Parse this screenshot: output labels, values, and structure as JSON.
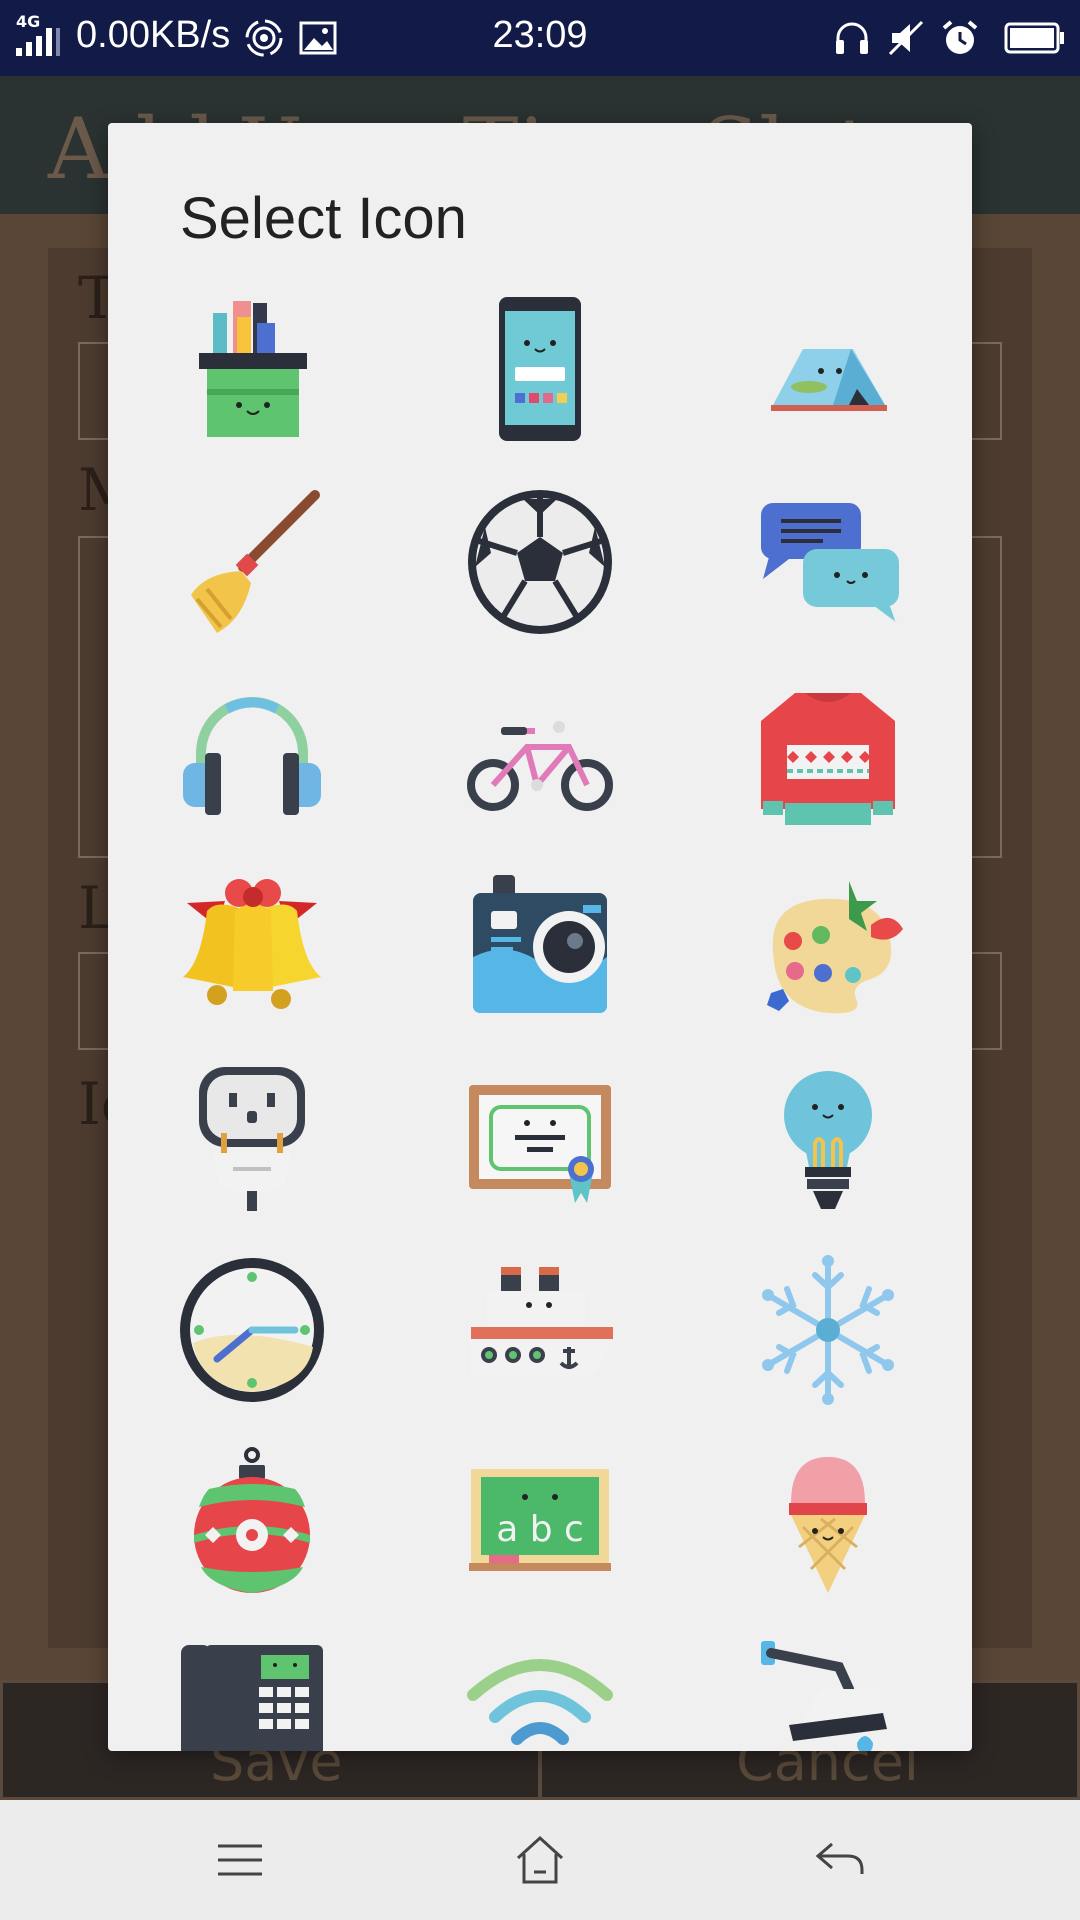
{
  "status_bar": {
    "network": "4G",
    "speed": "0.00KB/s",
    "time": "23:09",
    "icons": [
      "signal-icon",
      "hotspot-icon",
      "image-icon",
      "headphones-icon",
      "mute-icon",
      "alarm-icon",
      "battery-icon"
    ]
  },
  "background_app": {
    "title": "Add Your Time Slot",
    "field_letters": [
      "T",
      "M",
      "L",
      "Ic"
    ],
    "save_label": "Save",
    "cancel_label": "Cancel"
  },
  "dialog": {
    "title": "Select Icon",
    "icons": [
      "pencil-cup-icon",
      "smartphone-icon",
      "tent-icon",
      "broom-icon",
      "soccer-ball-icon",
      "chat-bubbles-icon",
      "headphones-icon",
      "bicycle-icon",
      "sweater-icon",
      "bells-icon",
      "camera-icon",
      "paint-palette-icon",
      "power-plug-icon",
      "certificate-icon",
      "light-bulb-icon",
      "clock-icon",
      "ship-icon",
      "snowflake-icon",
      "ornament-icon",
      "chalkboard-icon",
      "ice-cream-icon",
      "office-phone-icon",
      "wifi-icon",
      "shower-icon"
    ],
    "chalkboard_text": "a b c"
  },
  "nav_bar": {
    "icons": [
      "menu-icon",
      "home-icon",
      "back-icon"
    ]
  }
}
